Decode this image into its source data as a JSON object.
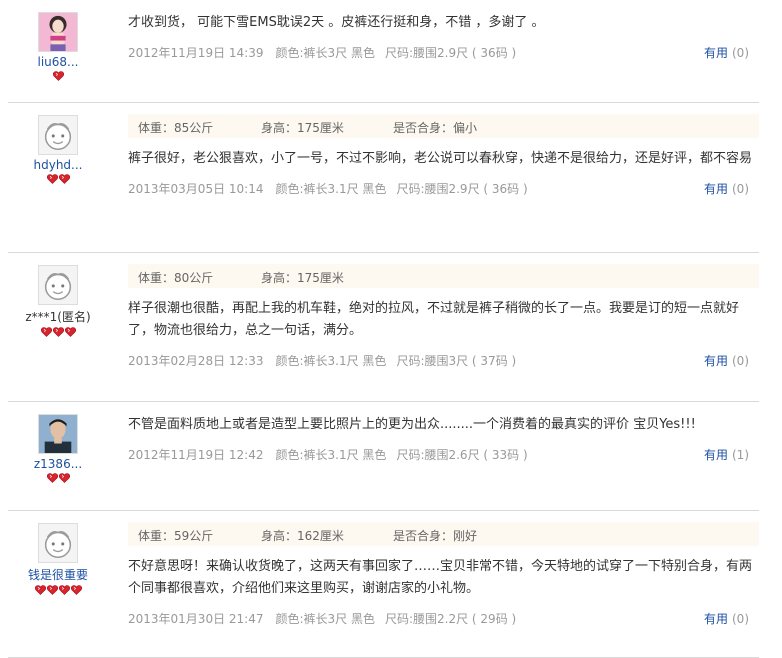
{
  "reviews": [
    {
      "user": {
        "name": "liu68...",
        "avatar": "girl-photo-avatar",
        "rank_hearts": 1
      },
      "attrs": null,
      "text": "才收到货， 可能下雪EMS耽误2天 。皮裤还行挺和身，不错 ，多谢了 。",
      "date": "2012年11月19日 14:39",
      "sku": [
        "颜色:裤长3尺 黑色",
        "尺码:腰围2.9尺 ( 36码 )"
      ],
      "useful_label": "有用",
      "useful_count": "(0)"
    },
    {
      "user": {
        "name": "hdyhd...",
        "avatar": "default-face-avatar",
        "rank_hearts": 2
      },
      "attrs": [
        "体重：85公斤",
        "身高：175厘米",
        "是否合身：偏小"
      ],
      "text": "裤子很好，老公狠喜欢，小了一号，不过不影响，老公说可以春秋穿，快递不是很给力，还是好评，都不容易",
      "date": "2013年03月05日 10:14",
      "sku": [
        "颜色:裤长3.1尺 黑色",
        "尺码:腰围2.9尺 ( 36码 )"
      ],
      "useful_label": "有用",
      "useful_count": "(0)"
    },
    {
      "user": {
        "name": "z***1(匿名)",
        "avatar": "default-face-avatar",
        "rank_hearts": 3
      },
      "attrs": [
        "体重：80公斤",
        "身高：175厘米"
      ],
      "text": "样子很潮也很酷，再配上我的机车鞋，绝对的拉风，不过就是裤子稍微的长了一点。我要是订的短一点就好了，物流也很给力，总之一句话，满分。",
      "date": "2013年02月28日 12:33",
      "sku": [
        "颜色:裤长3.1尺 黑色",
        "尺码:腰围3尺 ( 37码 )"
      ],
      "useful_label": "有用",
      "useful_count": "(0)"
    },
    {
      "user": {
        "name": "z1386...",
        "avatar": "man-photo-avatar",
        "rank_hearts": 2
      },
      "attrs": null,
      "text": "不管是面料质地上或者是造型上要比照片上的更为出众........一个消费着的最真实的评价 宝贝Yes!!!",
      "date": "2012年11月19日 12:42",
      "sku": [
        "颜色:裤长3.1尺 黑色",
        "尺码:腰围2.6尺 ( 33码 )"
      ],
      "useful_label": "有用",
      "useful_count": "(1)"
    },
    {
      "user": {
        "name": "钱是很重要",
        "avatar": "default-face-avatar",
        "rank_hearts": 4
      },
      "attrs": [
        "体重：59公斤",
        "身高：162厘米",
        "是否合身：刚好"
      ],
      "text": "不好意思呀！来确认收货晚了，这两天有事回家了……宝贝非常不错，今天特地的试穿了一下特别合身，有两个同事都很喜欢，介绍他们来这里购买，谢谢店家的小礼物。",
      "date": "2013年01月30日 21:47",
      "sku": [
        "颜色:裤长3尺 黑色",
        "尺码:腰围2.2尺 ( 29码 )"
      ],
      "useful_label": "有用",
      "useful_count": "(0)"
    }
  ],
  "colors": {
    "link": "#1e50a2",
    "heart": "#d9232d",
    "attr_bg": "#fdf8f0"
  }
}
